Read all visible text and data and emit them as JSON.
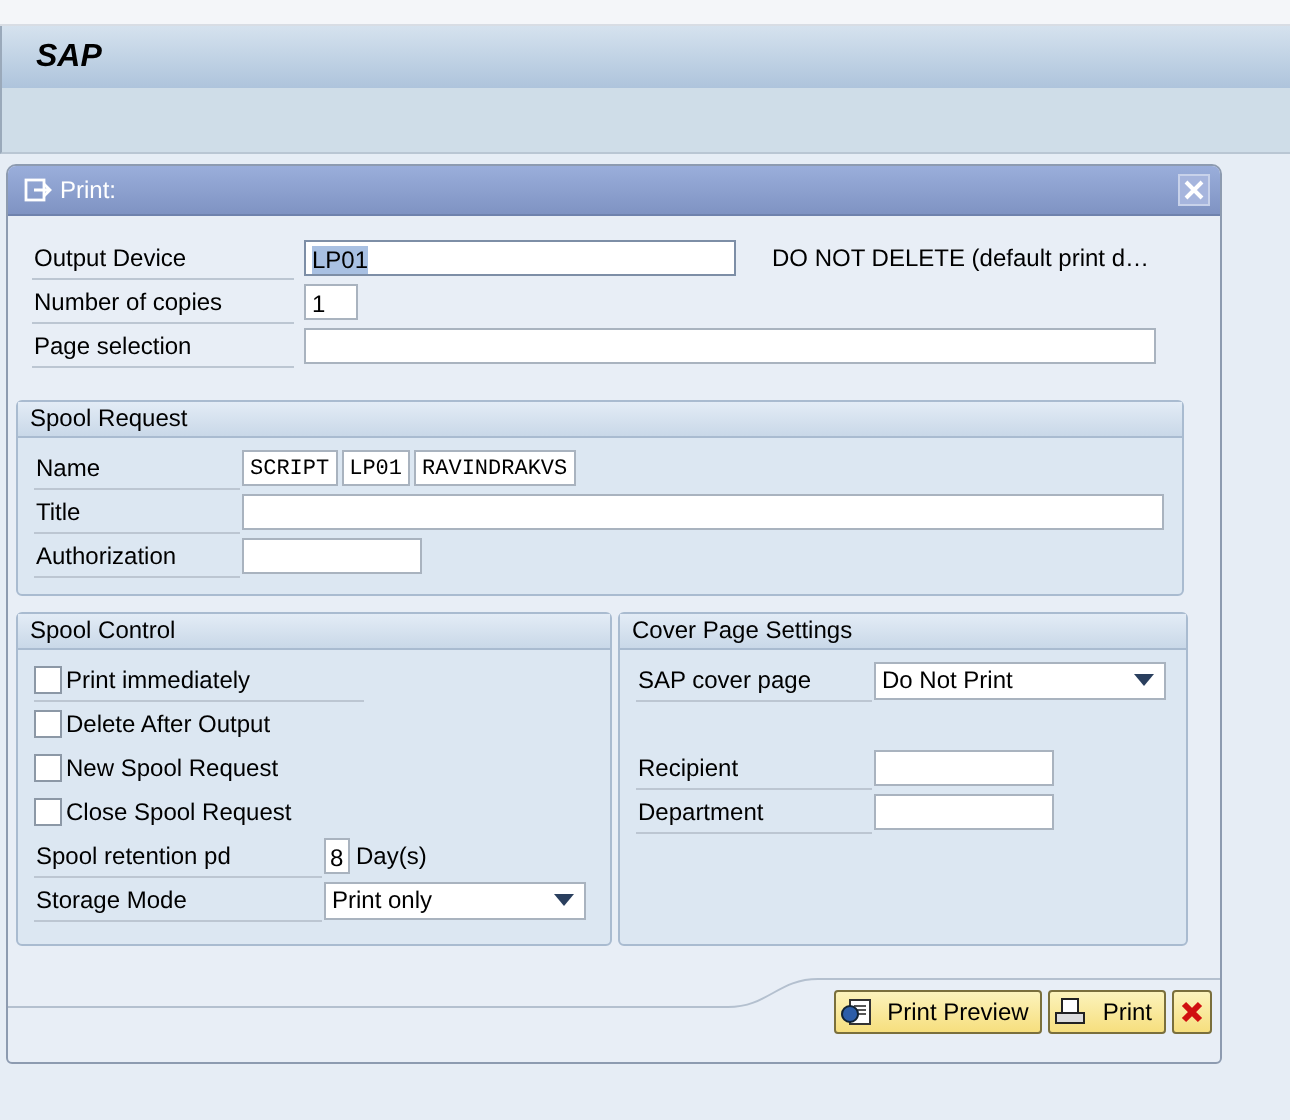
{
  "app_title": "SAP",
  "dialog": {
    "title": "Print:"
  },
  "fields": [
    {
      "label": "Output Device",
      "value": "LP01",
      "value_selected": true,
      "description": "DO NOT DELETE (default print d…"
    },
    {
      "label": "Number of copies",
      "value": "1",
      "value_selected": false
    },
    {
      "label": "Page selection",
      "value_selected": false
    }
  ],
  "spool_request": {
    "title": "Spool Request",
    "name": {
      "label": "Name",
      "parts": [
        "SCRIPT",
        "LP01",
        "RAVINDRAKVS"
      ]
    },
    "fields": [
      {
        "label": "Title"
      },
      {
        "label": "Authorization"
      }
    ]
  },
  "spool_control": {
    "title": "Spool Control",
    "checkboxes": [
      {
        "label": "Print immediately",
        "checked": false
      },
      {
        "label": "Delete After Output",
        "checked": false
      },
      {
        "label": "New Spool Request",
        "checked": false
      },
      {
        "label": "Close Spool Request",
        "checked": false
      }
    ],
    "retention": {
      "label": "Spool retention pd",
      "value": "8",
      "unit": "Day(s)"
    },
    "storage_mode": {
      "label": "Storage Mode",
      "value": "Print only"
    }
  },
  "cover_page": {
    "title": "Cover Page Settings",
    "cover": {
      "label": "SAP cover page",
      "value": "Do Not Print"
    },
    "fields": [
      {
        "label": "Recipient"
      },
      {
        "label": "Department"
      }
    ]
  },
  "buttons": [
    {
      "kind": "preview",
      "label": "Print Preview"
    },
    {
      "kind": "print",
      "label": "Print"
    },
    {
      "kind": "cancel"
    }
  ]
}
